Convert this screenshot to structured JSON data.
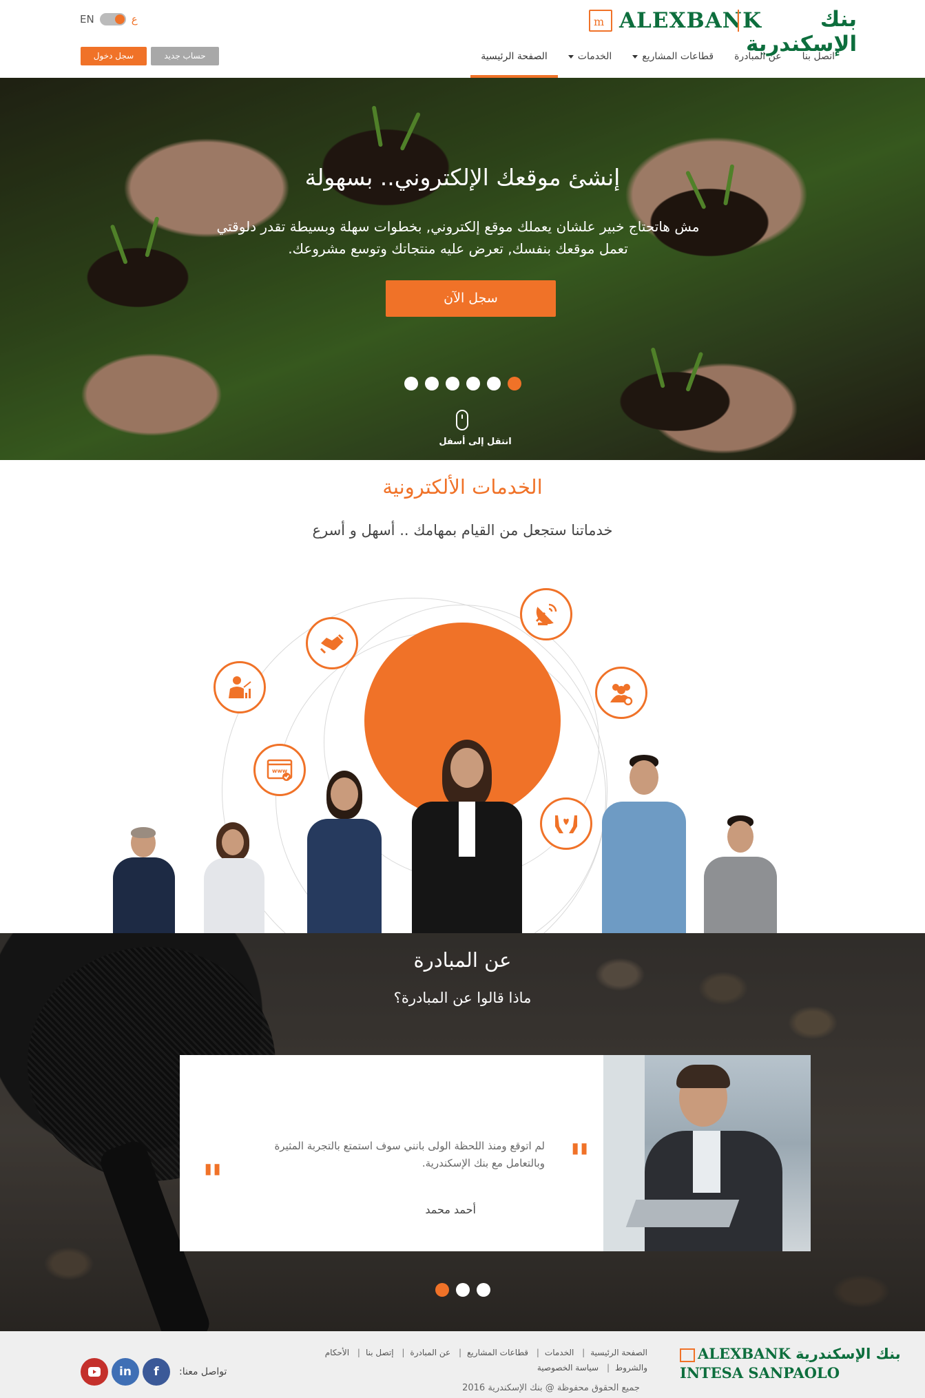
{
  "brand": {
    "name_en": "ALEXBANK",
    "name_ar": "بنك الإسكندرية"
  },
  "header": {
    "lang_en": "EN",
    "lang_ar": "ع",
    "login_label": "سجل دخول",
    "register_label": "حساب جديد",
    "nav": [
      {
        "label": "الصفحة الرئيسية",
        "active": true
      },
      {
        "label": "الخدمات",
        "dropdown": true
      },
      {
        "label": "قطاعات المشاريع",
        "dropdown": true
      },
      {
        "label": "عن المبادرة"
      },
      {
        "label": "اتصل بنا"
      }
    ]
  },
  "hero": {
    "title": "إنشئ موقعك الإلكتروني.. بسهولة",
    "text": "مش هاتحتاج خبير علشان يعملك موقع إلكتروني, بخطوات سهلة وبسيطة تقدر دلوقتي تعمل موقعك بنفسك, تعرض عليه منتجاتك وتوسع مشروعك.",
    "cta_label": "سجل الآن",
    "slides_total": 6,
    "active_slide": 6,
    "scroll_label": "انتقل إلى أسفل"
  },
  "services": {
    "title": "الخدمات الألكترونية",
    "subtitle": "خدماتنا ستجعل من القيام بمهامك .. أسهل و أسرع",
    "icons": [
      "satellite-dish-icon",
      "team-gear-icon",
      "helping-hands-icon",
      "handshake-icon",
      "growth-user-icon",
      "web-browser-icon"
    ]
  },
  "testimonials": {
    "title": "عن المبادرة",
    "subtitle": "ماذا قالوا عن المبادرة؟",
    "quote": "لم اتوقع ومنذ اللحظة الولى بانني سوف استمتع بالتجربة المثيرة وبالتعامل مع بنك الإسكندرية.",
    "author": "أحمد محمد",
    "slides_total": 3,
    "active_slide": 1
  },
  "footer": {
    "partner_en": "INTESA SANPAOLO",
    "links_row1": [
      "الصفحة الرئيسية",
      "الخدمات",
      "قطاعات المشاريع",
      "عن المبادرة",
      "إتصل بنا",
      "الأحكام"
    ],
    "links_row2": [
      "والشروط",
      "سياسة الخصوصية"
    ],
    "copyright": "جميع الحقوق محفوظة @ بنك الإسكندرية 2016",
    "social_label": "تواصل معنا:",
    "social": [
      "facebook-icon",
      "linkedin-icon",
      "youtube-icon"
    ]
  },
  "colors": {
    "accent": "#f07228",
    "brand_green": "#0d6e3d",
    "footer_bg": "#efefef"
  }
}
